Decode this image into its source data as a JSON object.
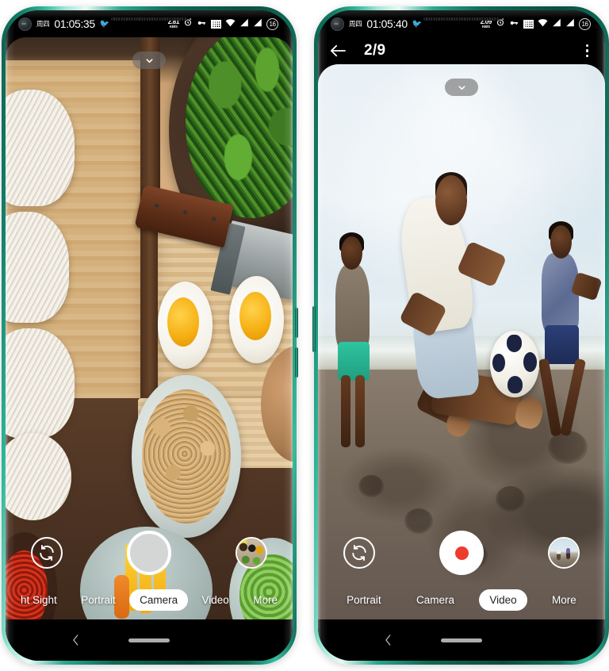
{
  "scene": {
    "device_count": 2,
    "frame_color": "#0f6b58",
    "app": "Camera"
  },
  "phone_left": {
    "status_bar": {
      "day": "周四",
      "time": "01:05:35",
      "emoji": "🐦",
      "net_speed_value": "2.81",
      "net_speed_unit": "KB/S",
      "icons": [
        "alarm-icon",
        "vpn-key-icon",
        "qr-icon",
        "wifi-icon",
        "signal-sim1-icon",
        "signal-sim2-icon"
      ],
      "battery_percent": "16"
    },
    "viewfinder": {
      "scene_description": "Food flatlay: fresh white noodle nests on a wooden board, chef knife, pan of sauteed spinach with sesame, halved boiled eggs, plate of toasted grains",
      "expand_chevron": "chevron-down-icon"
    },
    "controls": {
      "flip_icon": "camera-flip-icon",
      "shutter_type": "photo",
      "thumbnail_description": "spice bowls thumbnail"
    },
    "modes": [
      {
        "label": "ht Sight",
        "active": false
      },
      {
        "label": "Portrait",
        "active": false
      },
      {
        "label": "Camera",
        "active": true
      },
      {
        "label": "Video",
        "active": false
      },
      {
        "label": "More",
        "active": false
      }
    ],
    "nav_bar": {
      "back_icon": "chevron-left-icon",
      "home_indicator": "home-pill"
    }
  },
  "phone_right": {
    "status_bar": {
      "day": "周四",
      "time": "01:05:40",
      "emoji": "🐦",
      "net_speed_value": "2.09",
      "net_speed_unit": "KB/S",
      "icons": [
        "alarm-icon",
        "vpn-key-icon",
        "qr-icon",
        "wifi-icon",
        "signal-sim1-icon",
        "signal-sim2-icon"
      ],
      "battery_percent": "16"
    },
    "header": {
      "back_icon": "arrow-left-icon",
      "title": "2/9",
      "overflow_icon": "more-vertical-icon"
    },
    "viewfinder": {
      "scene_description": "Beach soccer: barefoot player kicking a black-and-white football on wet sand, two other players in background, sea and sky",
      "expand_chevron": "chevron-down-icon"
    },
    "controls": {
      "flip_icon": "camera-flip-icon",
      "shutter_type": "video",
      "record_dot_color": "#ef3b2d",
      "thumbnail_description": "beach players thumbnail"
    },
    "modes": [
      {
        "label": "Portrait",
        "active": false
      },
      {
        "label": "Camera",
        "active": false
      },
      {
        "label": "Video",
        "active": true
      },
      {
        "label": "More",
        "active": false
      }
    ],
    "nav_bar": {
      "back_icon": "chevron-left-icon",
      "home_indicator": "home-pill"
    }
  }
}
